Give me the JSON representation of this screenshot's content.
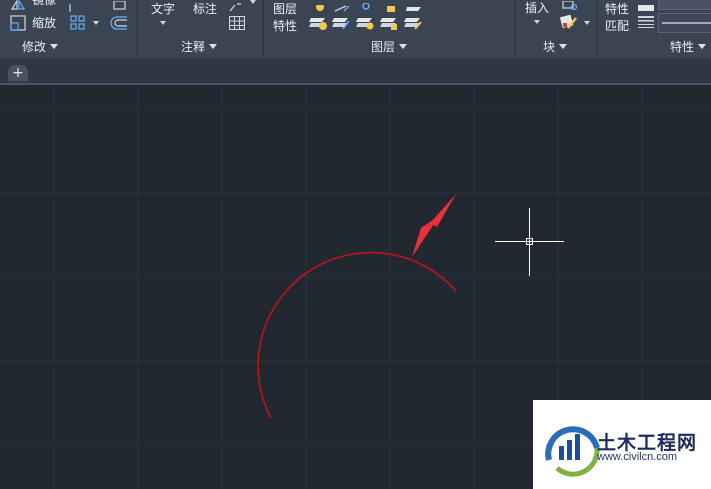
{
  "ribbon": {
    "modify": {
      "mirror_label": "镜像",
      "scale_label": "缩放",
      "panel_label": "修改"
    },
    "annotation": {
      "text_label": "文字",
      "dimension_label": "标注",
      "panel_label": "注释"
    },
    "layers": {
      "layer_properties_label_line1": "图层",
      "layer_properties_label_line2": "特性",
      "panel_label": "图层"
    },
    "block": {
      "insert_label": "插入",
      "panel_label": "块"
    },
    "properties": {
      "properties_label": "特性",
      "match_label": "匹配",
      "panel_label": "特性"
    }
  },
  "tabs": {
    "new_tab_label": "+"
  },
  "drawing": {
    "arc_color": "#c1121b",
    "arrow_color": "#e8313a",
    "crosshair_color": "#ffffff",
    "grid_color": "#2a323d",
    "background": "#212830"
  },
  "watermark": {
    "title": "土木工程网",
    "url": "www.civilcn.com"
  }
}
